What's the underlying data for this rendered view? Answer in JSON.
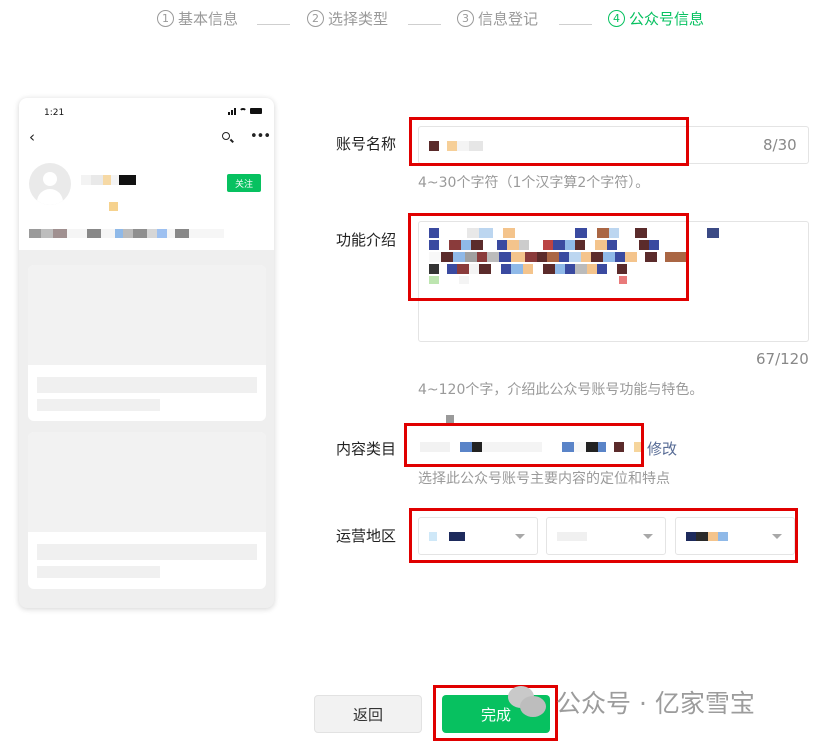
{
  "steps": [
    {
      "num": "1",
      "label": "基本信息",
      "active": false
    },
    {
      "num": "2",
      "label": "选择类型",
      "active": false
    },
    {
      "num": "3",
      "label": "信息登记",
      "active": false
    },
    {
      "num": "4",
      "label": "公众号信息",
      "active": true
    }
  ],
  "preview": {
    "time": "1:21",
    "follow_label": "关注",
    "icons": [
      "back-icon",
      "search-icon",
      "more-icon",
      "signal-icon",
      "wifi-icon",
      "battery-icon",
      "avatar-icon"
    ]
  },
  "form": {
    "account_name": {
      "label": "账号名称",
      "counter": "8/30",
      "hint": "4~30个字符（1个汉字算2个字符）。"
    },
    "intro": {
      "label": "功能介绍",
      "counter": "67/120",
      "hint": "4~120个字，介绍此公众号账号功能与特色。"
    },
    "category": {
      "label": "内容类目",
      "edit_link": "修改",
      "hint": "选择此公众号账号主要内容的定位和特点"
    },
    "region": {
      "label": "运营地区"
    }
  },
  "buttons": {
    "back": "返回",
    "done": "完成"
  },
  "watermark": {
    "text": "公众号 · 亿家雪宝"
  },
  "colors": {
    "accent": "#07c160",
    "highlight_box": "#e00000",
    "link": "#576b95"
  }
}
